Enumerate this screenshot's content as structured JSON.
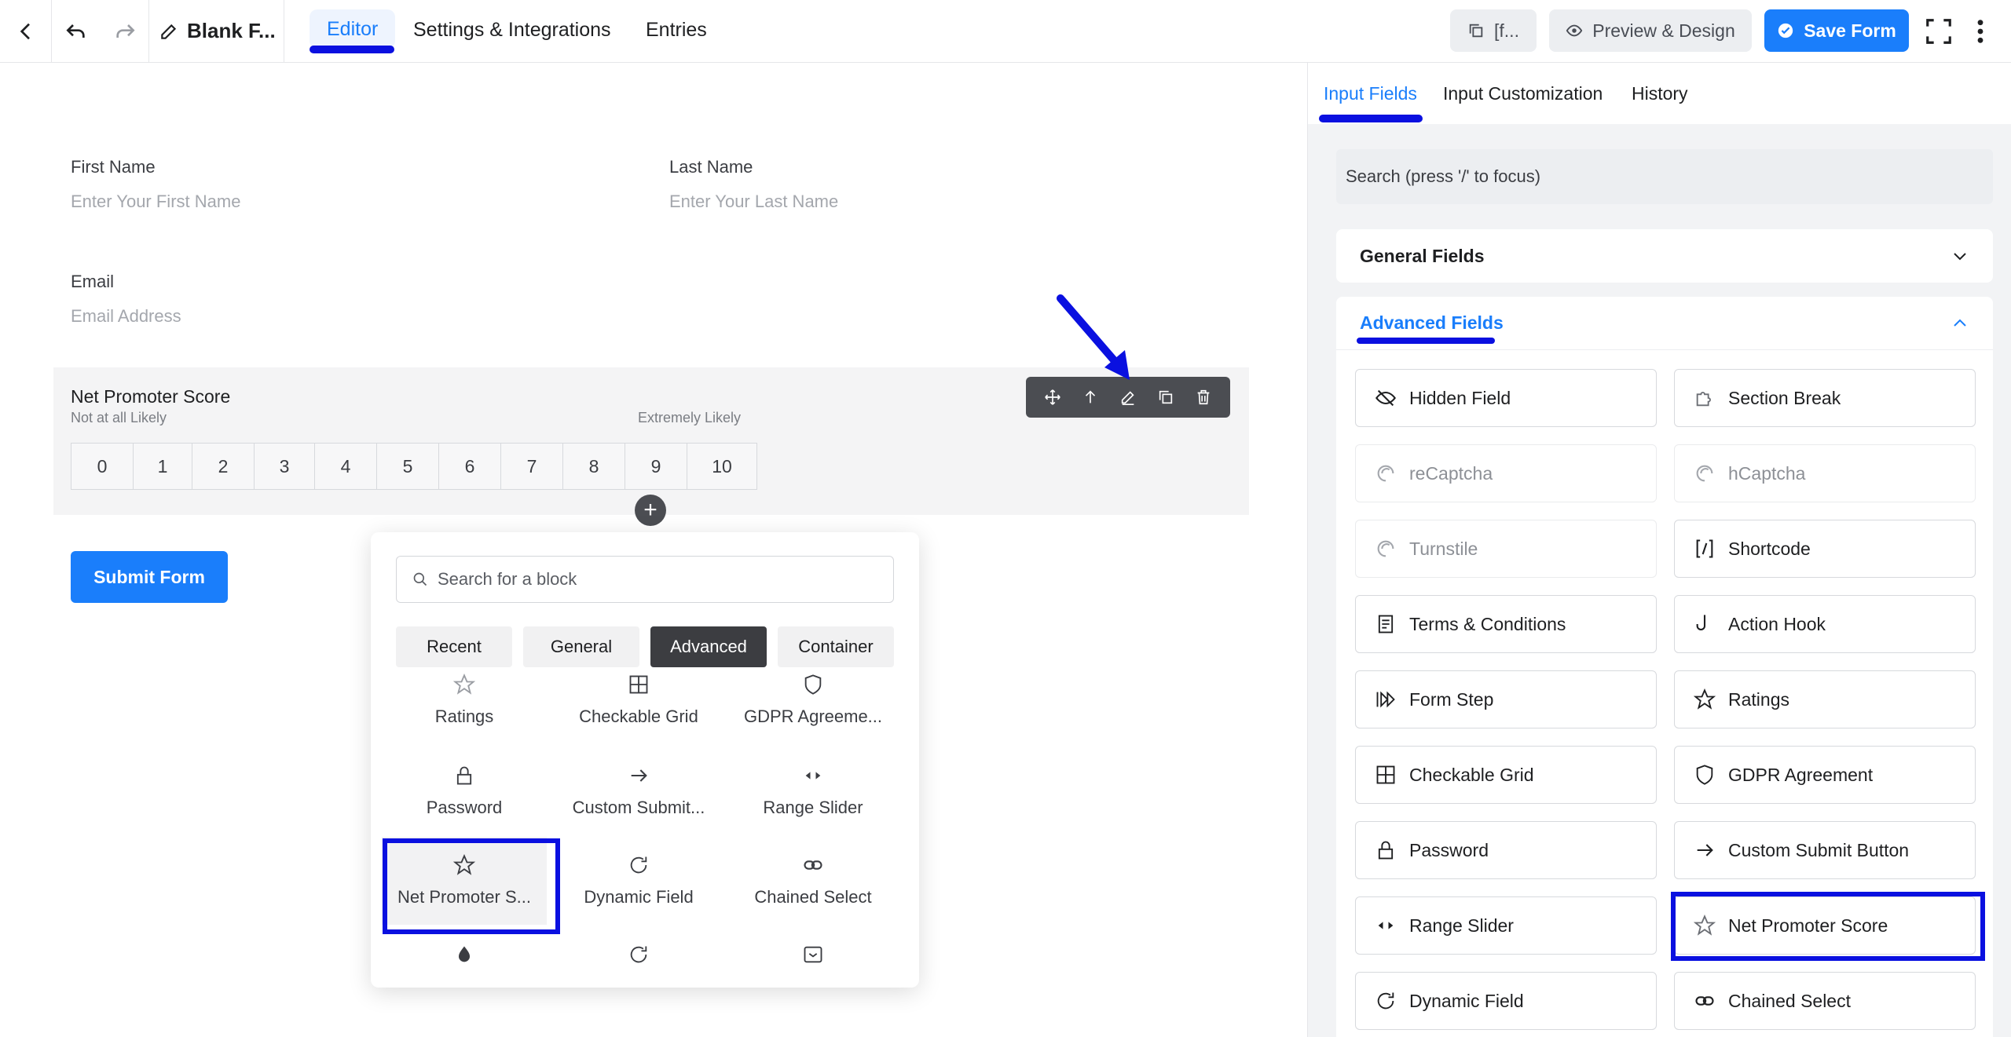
{
  "topbar": {
    "doc_title": "Blank F...",
    "tabs": [
      "Editor",
      "Settings & Integrations",
      "Entries"
    ],
    "shortcode_label": "[f...",
    "preview_label": "Preview & Design",
    "save_label": "Save Form"
  },
  "form": {
    "first_name_label": "First Name",
    "first_name_placeholder": "Enter Your First Name",
    "last_name_label": "Last Name",
    "last_name_placeholder": "Enter Your Last Name",
    "email_label": "Email",
    "email_placeholder": "Email Address",
    "nps_label": "Net Promoter Score",
    "nps_low": "Not at all Likely",
    "nps_high": "Extremely Likely",
    "nps_values": [
      "0",
      "1",
      "2",
      "3",
      "4",
      "5",
      "6",
      "7",
      "8",
      "9",
      "10"
    ],
    "submit_label": "Submit Form"
  },
  "inserter": {
    "search_placeholder": "Search for a block",
    "tabs": [
      "Recent",
      "General",
      "Advanced",
      "Container"
    ],
    "blocks": [
      "Ratings",
      "Checkable Grid",
      "GDPR Agreeme...",
      "Password",
      "Custom Submit...",
      "Range Slider",
      "Net Promoter S...",
      "Dynamic Field",
      "Chained Select"
    ]
  },
  "sidebar": {
    "tabs": [
      "Input Fields",
      "Input Customization",
      "History"
    ],
    "search_placeholder": "Search (press '/' to focus)",
    "general_section": "General Fields",
    "advanced_section": "Advanced Fields",
    "fields": [
      "Hidden Field",
      "Section Break",
      "reCaptcha",
      "hCaptcha",
      "Turnstile",
      "Shortcode",
      "Terms & Conditions",
      "Action Hook",
      "Form Step",
      "Ratings",
      "Checkable Grid",
      "GDPR Agreement",
      "Password",
      "Custom Submit Button",
      "Range Slider",
      "Net Promoter Score",
      "Dynamic Field",
      "Chained Select"
    ]
  }
}
